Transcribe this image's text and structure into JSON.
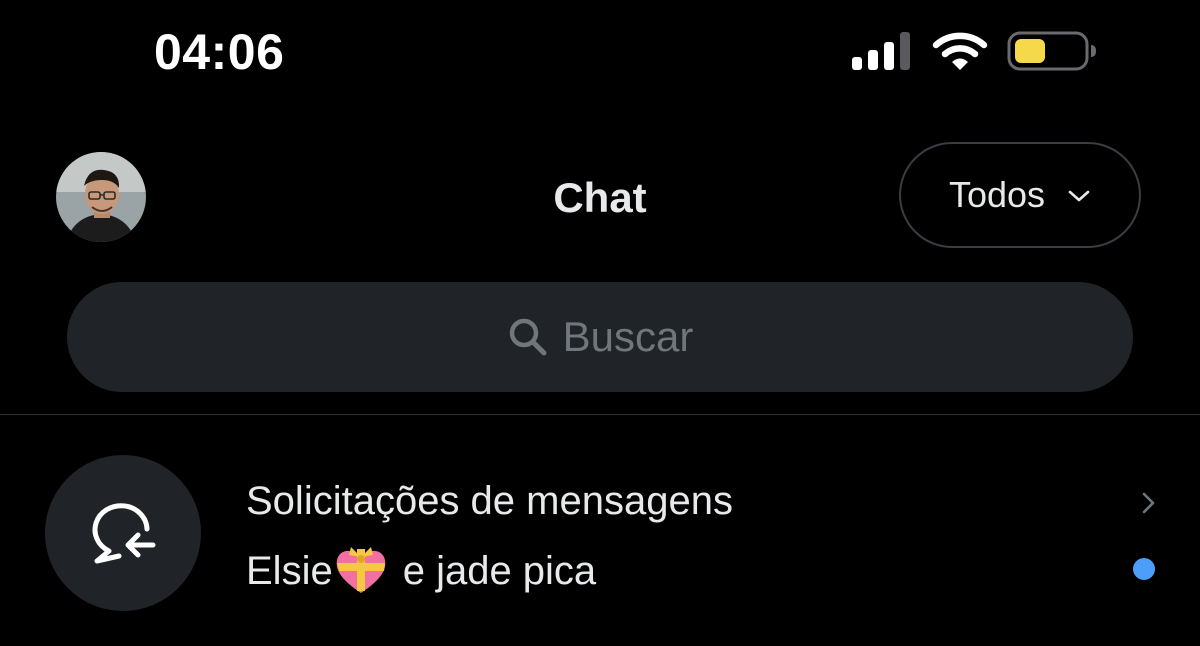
{
  "status_bar": {
    "time": "04:06",
    "icons": [
      "cellular-signal-icon",
      "wifi-icon",
      "battery-icon"
    ],
    "battery_color": "#f5d949"
  },
  "header": {
    "title": "Chat",
    "filter": {
      "selected": "Todos",
      "icon": "chevron-down-icon"
    },
    "avatar": "user-avatar"
  },
  "search": {
    "placeholder": "Buscar",
    "icon": "search-icon"
  },
  "requests": {
    "title": "Solicitações de mensagens",
    "subtitle_name": "Elsie",
    "subtitle_emoji_icon": "heart-with-ribbon-icon",
    "subtitle_rest": "e jade pica",
    "icon": "message-request-icon",
    "unread_dot_color": "#4c9ef8"
  },
  "colors": {
    "background": "#000000",
    "text": "#e7e9ea",
    "muted": "#71767b",
    "surface": "#202327",
    "accent": "#4c9ef8"
  }
}
